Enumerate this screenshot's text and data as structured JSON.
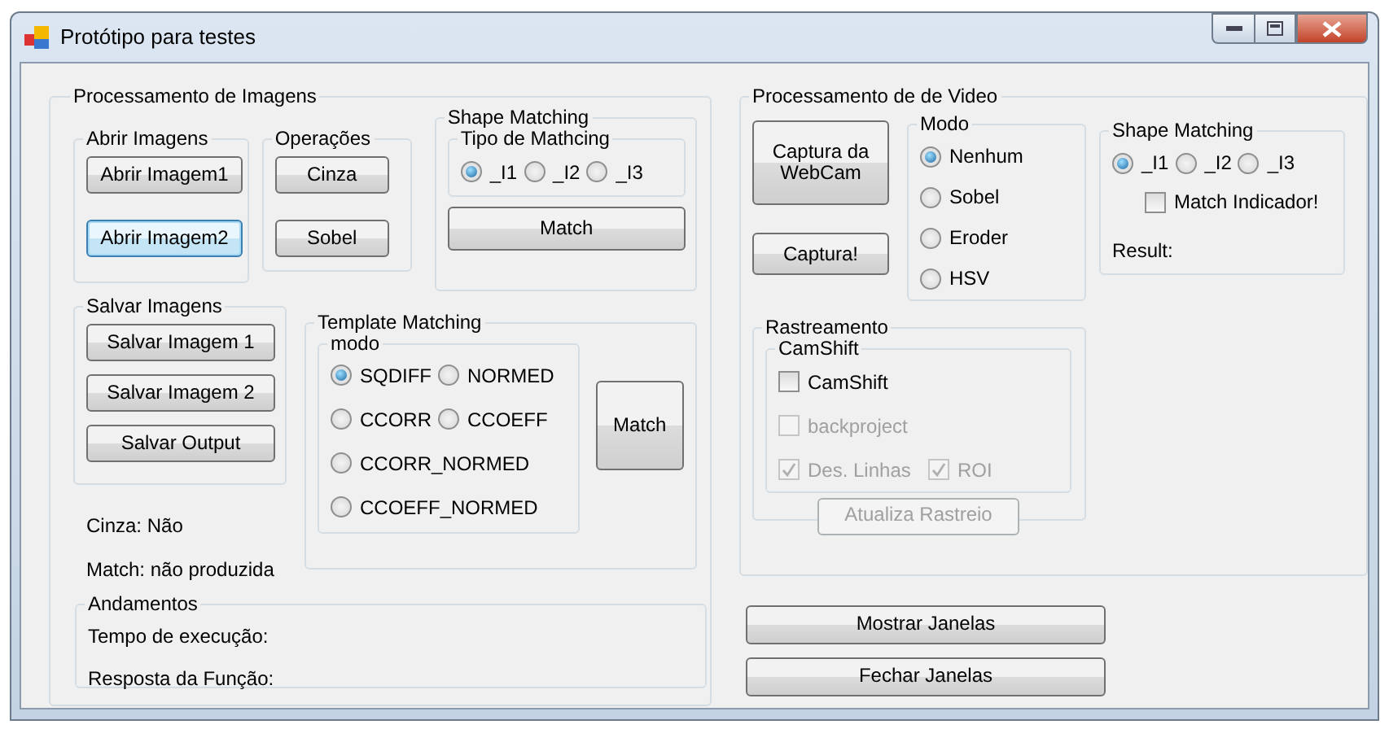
{
  "window": {
    "title": "Protótipo para testes"
  },
  "image_processing": {
    "title": "Processamento de Imagens",
    "open_images": {
      "title": "Abrir Imagens",
      "buttons": [
        {
          "label": "Abrir Imagem1",
          "focused": false
        },
        {
          "label": "Abrir Imagem2",
          "focused": true
        }
      ]
    },
    "operations": {
      "title": "Operações",
      "buttons": [
        "Cinza",
        "Sobel"
      ]
    },
    "shape_matching": {
      "title": "Shape Matching",
      "type_group": {
        "title": "Tipo de Mathcing",
        "options": [
          {
            "label": "_I1",
            "selected": true
          },
          {
            "label": "_I2",
            "selected": false
          },
          {
            "label": "_I3",
            "selected": false
          }
        ]
      },
      "button": "Match"
    },
    "save_images": {
      "title": "Salvar Imagens",
      "buttons": [
        "Salvar Imagem 1",
        "Salvar Imagem 2",
        "Salvar Output"
      ]
    },
    "template_matching": {
      "title": "Template Matching",
      "mode_group": {
        "title": "modo",
        "options": [
          {
            "label": "SQDIFF",
            "selected": true
          },
          {
            "label": "NORMED",
            "selected": false
          },
          {
            "label": "CCORR",
            "selected": false
          },
          {
            "label": "CCOEFF",
            "selected": false
          },
          {
            "label": "CCORR_NORMED",
            "selected": false
          },
          {
            "label": "CCOEFF_NORMED",
            "selected": false
          }
        ]
      },
      "button": "Match"
    },
    "status_labels": [
      "Cinza: Não",
      "Match: não produzida"
    ],
    "progress": {
      "title": "Andamentos",
      "labels": [
        "Tempo de execução:",
        "Resposta da Função:"
      ]
    }
  },
  "video_processing": {
    "title": "Processamento de de Video",
    "capture_buttons": [
      "Captura da WebCam",
      "Captura!"
    ],
    "mode": {
      "title": "Modo",
      "options": [
        {
          "label": "Nenhum",
          "selected": true
        },
        {
          "label": "Sobel",
          "selected": false
        },
        {
          "label": "Eroder",
          "selected": false
        },
        {
          "label": "HSV",
          "selected": false
        }
      ]
    },
    "shape_matching": {
      "title": "Shape Matching",
      "options": [
        {
          "label": "_I1",
          "selected": true
        },
        {
          "label": "_I2",
          "selected": false
        },
        {
          "label": "_I3",
          "selected": false
        }
      ],
      "checkbox": {
        "label": "Match Indicador!",
        "checked": false
      },
      "result_label": "Result:"
    },
    "tracking": {
      "title": "Rastreamento",
      "camshift": {
        "title": "CamShift",
        "checkboxes": [
          {
            "label": "CamShift",
            "checked": false,
            "disabled": false
          },
          {
            "label": "backproject",
            "checked": false,
            "disabled": true
          },
          {
            "label": "Des. Linhas",
            "checked": true,
            "disabled": true
          },
          {
            "label": "ROI",
            "checked": true,
            "disabled": true
          }
        ],
        "button": {
          "label": "Atualiza Rastreio",
          "disabled": true
        }
      }
    }
  },
  "bottom_buttons": [
    "Mostrar Janelas",
    "Fechar Janelas"
  ]
}
